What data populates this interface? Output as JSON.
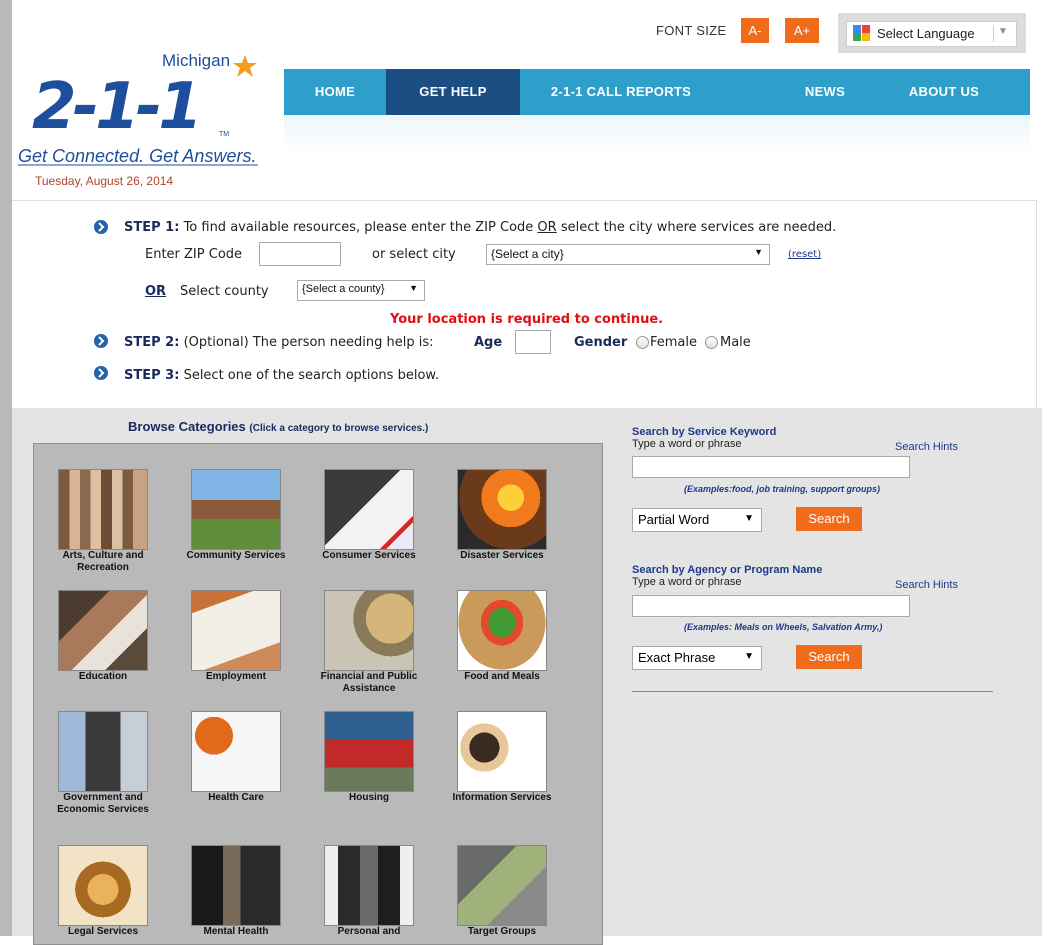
{
  "header": {
    "logo": {
      "state": "Michigan",
      "number": "2-1-1",
      "tm": "TM",
      "tagline": "Get Connected. Get Answers."
    },
    "date": "Tuesday, August 26, 2014",
    "font_size_label": "FONT SIZE",
    "font_decrease": "A-",
    "font_increase": "A+",
    "language": "Select Language"
  },
  "nav": {
    "items": [
      "HOME",
      "GET HELP",
      "2-1-1 CALL REPORTS",
      "NEWS",
      "ABOUT US"
    ],
    "active": "GET HELP"
  },
  "steps": {
    "step1_label": "STEP 1:",
    "step1_text": "To find available resources, please enter the ZIP Code",
    "step1_or": "OR",
    "step1_text2": "select the city where services are needed.",
    "zip_label": "Enter ZIP Code",
    "zip_value": "",
    "or_city": "or select city",
    "city_value": "{Select a city}",
    "reset": "(reset)",
    "or_label": "OR",
    "county_label": "Select county",
    "county_value": "{Select a county}",
    "required_msg": "Your location is required to continue.",
    "step2_label": "STEP 2:",
    "step2_text": "(Optional) The person needing help is:",
    "age_label": "Age",
    "age_value": "",
    "gender_label": "Gender",
    "female": "Female",
    "male": "Male",
    "step3_label": "STEP 3:",
    "step3_text": "Select one of the search options below."
  },
  "browse": {
    "title": "Browse Categories",
    "subtitle": "(Click a category to browse services.)",
    "categories": [
      "Arts, Culture and Recreation",
      "Community Services",
      "Consumer Services",
      "Disaster Services",
      "Education",
      "Employment",
      "Financial and Public Assistance",
      "Food and Meals",
      "Government and Economic Services",
      "Health Care",
      "Housing",
      "Information Services",
      "Legal Services",
      "Mental Health",
      "Personal and",
      "Target Groups"
    ]
  },
  "search": {
    "keyword_head": "Search by Service Keyword",
    "keyword_sub": "Type a word or phrase",
    "keyword_hint": "Search Hints",
    "keyword_value": "",
    "keyword_examples": "(Examples:food, job training, support groups)",
    "keyword_mode": "Partial Word",
    "keyword_btn": "Search",
    "agency_head": "Search by Agency or Program Name",
    "agency_sub": "Type a word or phrase",
    "agency_hint": "Search Hints",
    "agency_value": "",
    "agency_examples": "(Examples: Meals on Wheels, Salvation Army,)",
    "agency_mode": "Exact Phrase",
    "agency_btn": "Search"
  },
  "colors": {
    "nav": "#2e9fcb",
    "nav_active": "#1b4f83",
    "accent": "#f06b1a",
    "brand_blue": "#1d4f9c",
    "error": "#e01010"
  }
}
